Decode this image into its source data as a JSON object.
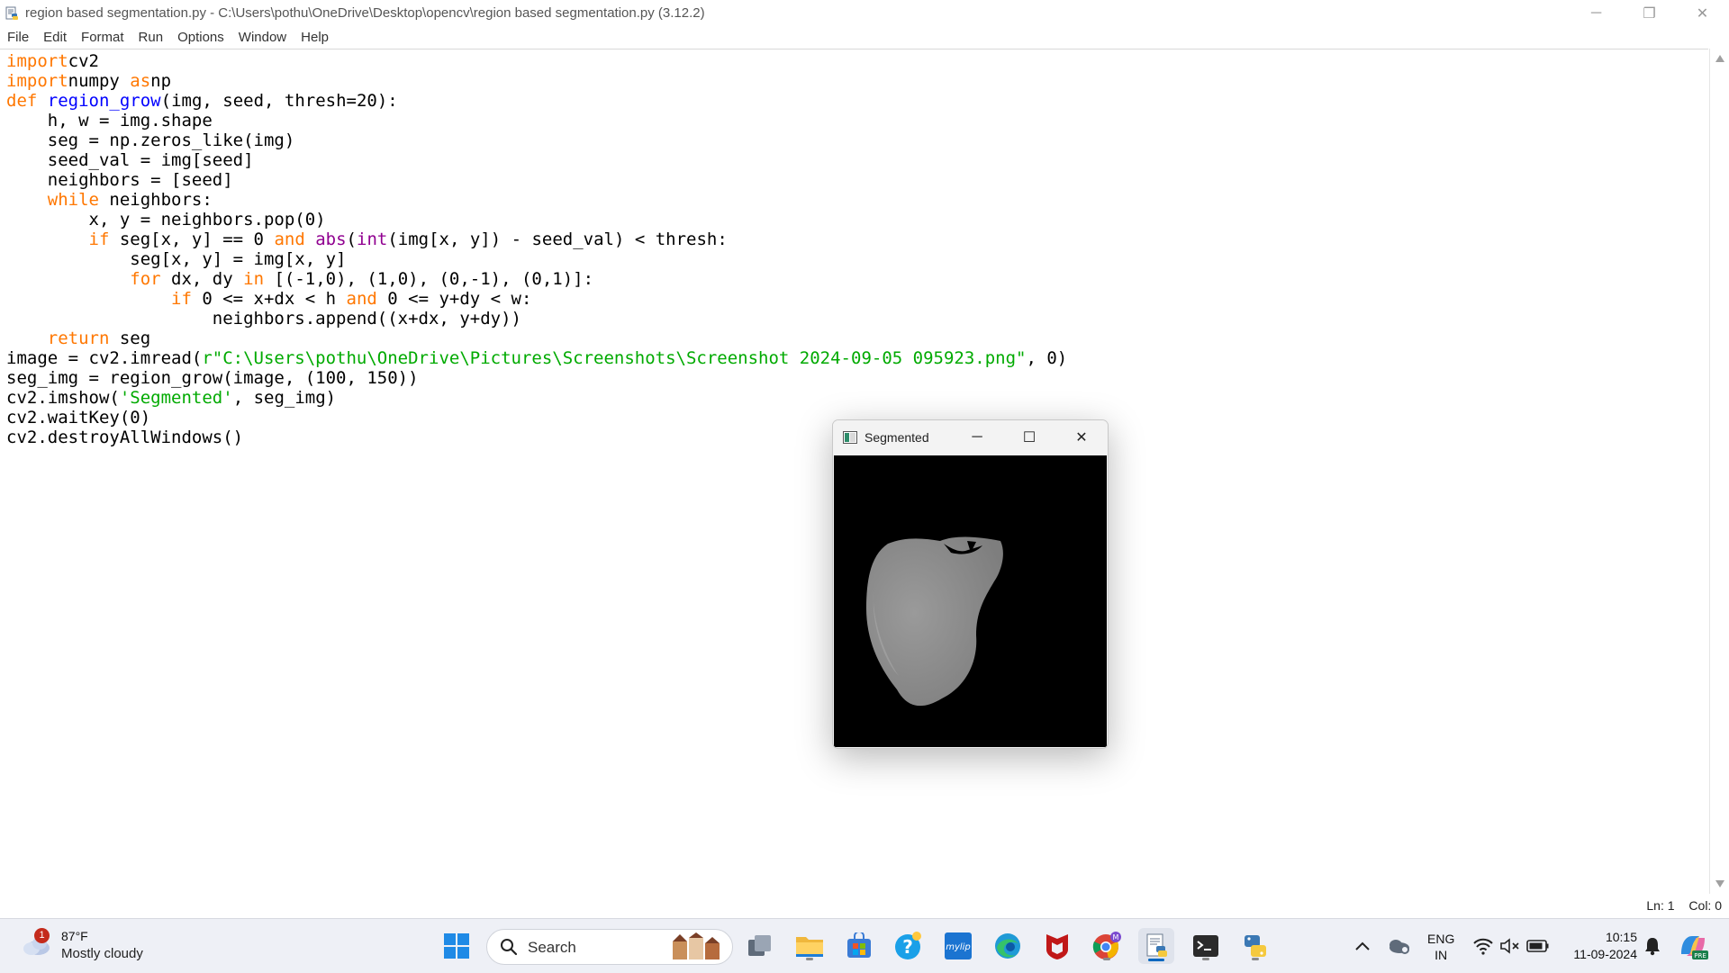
{
  "window": {
    "title": "region based segmentation.py - C:\\Users\\pothu\\OneDrive\\Desktop\\opencv\\region based segmentation.py (3.12.2)",
    "minimize": "─",
    "restore": "❐",
    "close": "✕"
  },
  "menu": [
    "File",
    "Edit",
    "Format",
    "Run",
    "Options",
    "Window",
    "Help"
  ],
  "code_lines": [
    [
      [
        "kw",
        "import"
      ],
      [
        "",
        "cv2"
      ]
    ],
    [
      [
        "kw",
        "import"
      ],
      [
        "",
        "numpy "
      ],
      [
        "kw",
        "as"
      ],
      [
        "",
        "np"
      ]
    ],
    [
      [
        "kw",
        "def"
      ],
      [
        "",
        " "
      ],
      [
        "fn",
        "region_grow"
      ],
      [
        "",
        "(img, seed, thresh=20):"
      ]
    ],
    [
      [
        "",
        "    h, w = img.shape"
      ]
    ],
    [
      [
        "",
        "    seg = np.zeros_like(img)"
      ]
    ],
    [
      [
        "",
        "    seed_val = img[seed]"
      ]
    ],
    [
      [
        "",
        "    neighbors = [seed]"
      ]
    ],
    [
      [
        "",
        "    "
      ],
      [
        "kw",
        "while"
      ],
      [
        "",
        " neighbors:"
      ]
    ],
    [
      [
        "",
        "        x, y = neighbors.pop(0)"
      ]
    ],
    [
      [
        "",
        "        "
      ],
      [
        "kw",
        "if"
      ],
      [
        "",
        " seg[x, y] == 0 "
      ],
      [
        "kw",
        "and"
      ],
      [
        "",
        " "
      ],
      [
        "bi",
        "abs"
      ],
      [
        "",
        "("
      ],
      [
        "bi",
        "int"
      ],
      [
        "",
        "(img[x, y]) - seed_val) < thresh:"
      ]
    ],
    [
      [
        "",
        "            seg[x, y] = img[x, y]"
      ]
    ],
    [
      [
        "",
        "            "
      ],
      [
        "kw",
        "for"
      ],
      [
        "",
        " dx, dy "
      ],
      [
        "kw",
        "in"
      ],
      [
        "",
        " [(-1,0), (1,0), (0,-1), (0,1)]:"
      ]
    ],
    [
      [
        "",
        "                "
      ],
      [
        "kw",
        "if"
      ],
      [
        "",
        " 0 <= x+dx < h "
      ],
      [
        "kw",
        "and"
      ],
      [
        "",
        " 0 <= y+dy < w:"
      ]
    ],
    [
      [
        "",
        "                    neighbors.append((x+dx, y+dy))"
      ]
    ],
    [
      [
        "",
        "    "
      ],
      [
        "kw",
        "return"
      ],
      [
        "",
        " seg"
      ]
    ],
    [
      [
        "",
        "image = cv2.imread("
      ],
      [
        "st",
        "r\"C:\\Users\\pothu\\OneDrive\\Pictures\\Screenshots\\Screenshot 2024-09-05 095923.png\""
      ],
      [
        "",
        ", 0)"
      ]
    ],
    [
      [
        "",
        "seg_img = region_grow(image, (100, 150))"
      ]
    ],
    [
      [
        "",
        "cv2.imshow("
      ],
      [
        "st",
        "'Segmented'"
      ],
      [
        "",
        ", seg_img)"
      ]
    ],
    [
      [
        "",
        "cv2.waitKey(0)"
      ]
    ],
    [
      [
        "",
        "cv2.destroyAllWindows()"
      ]
    ]
  ],
  "status": {
    "line": "Ln: 1",
    "col": "Col: 0"
  },
  "segmented_window": {
    "title": "Segmented",
    "minimize": "─",
    "maximize": "☐",
    "close": "✕"
  },
  "taskbar": {
    "weather": {
      "badge": "1",
      "temp": "87°F",
      "condition": "Mostly cloudy"
    },
    "search_placeholder": "Search",
    "language": {
      "lang": "ENG",
      "region": "IN"
    },
    "time": "10:15",
    "date": "11-09-2024",
    "copilot_badge": "PRE",
    "chrome_badge": "M",
    "mylip": "mylip"
  },
  "colors": {
    "keyword": "#ff7700",
    "function_def": "#0000ff",
    "builtin": "#900090",
    "string": "#00aa00",
    "taskbar_bg": "#eef0f6",
    "accent": "#0067c0"
  },
  "icons": [
    "python-idle-icon",
    "start-icon",
    "search-icon",
    "task-view-icon",
    "file-explorer-icon",
    "store-icon",
    "help-icon",
    "mylip-icon",
    "edge-icon",
    "mcafee-icon",
    "chrome-icon",
    "idle-taskbar-icon",
    "terminal-icon",
    "python-icon",
    "chevron-up-icon",
    "cloud-icon",
    "wifi-icon",
    "speaker-muted-icon",
    "battery-icon",
    "notification-bell-icon",
    "copilot-icon"
  ]
}
